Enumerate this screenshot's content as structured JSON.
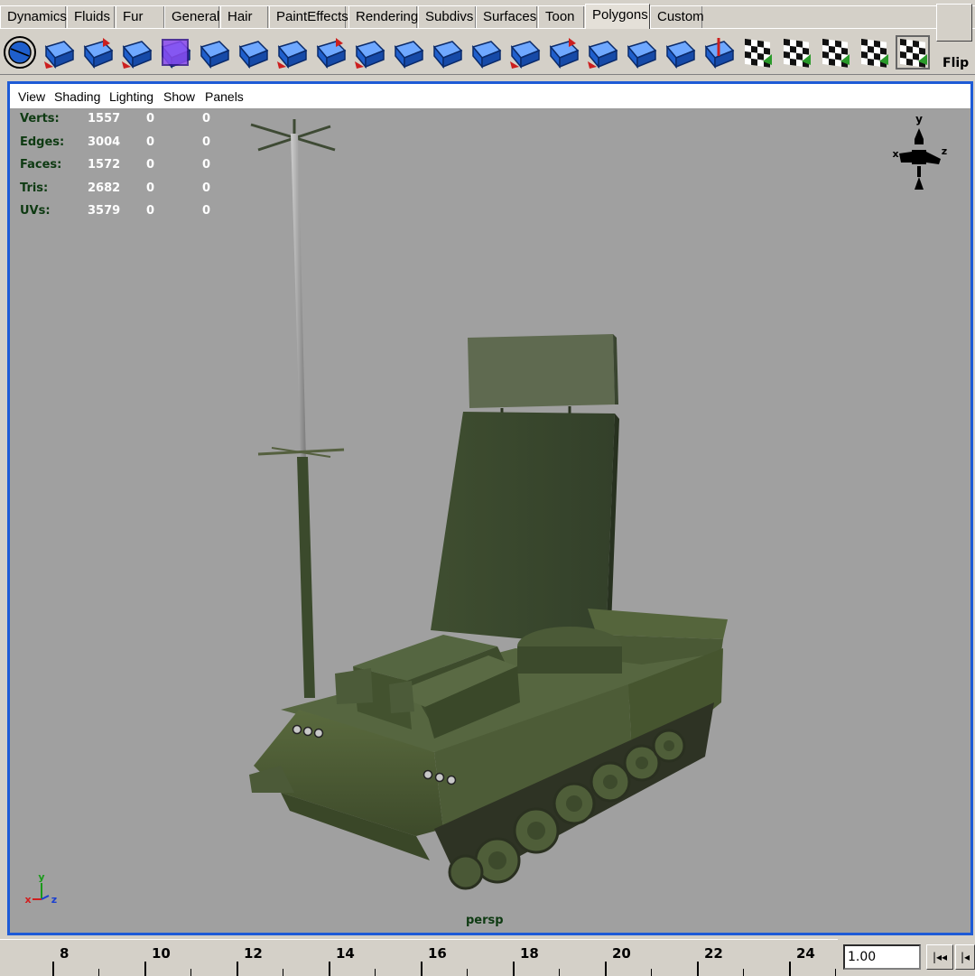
{
  "shelf": {
    "tabs": [
      {
        "label": "Dynamics"
      },
      {
        "label": "Fluids"
      },
      {
        "label": "Fur"
      },
      {
        "label": "General"
      },
      {
        "label": "Hair"
      },
      {
        "label": "PaintEffects"
      },
      {
        "label": "Rendering"
      },
      {
        "label": "Subdivs"
      },
      {
        "label": "Surfaces"
      },
      {
        "label": "Toon"
      },
      {
        "label": "Polygons"
      },
      {
        "label": "Custom"
      }
    ],
    "active_tab": "Polygons",
    "icons": [
      "polygon-sphere-icon",
      "extract-icon",
      "separate-icon",
      "smooth-icon",
      "cube-icon",
      "extrude-face-icon",
      "split-polygon-icon",
      "extrude-edge-icon",
      "bevel-icon",
      "wedge-icon",
      "bridge-icon",
      "append-polygon-icon",
      "merge-vertex-icon",
      "split-edge-icon",
      "subdivide-icon",
      "triangulate-icon",
      "quadrangulate-icon",
      "sculpt-icon",
      "planar-mapping-icon",
      "automatic-mapping-icon",
      "cylindrical-mapping-icon",
      "spherical-mapping-icon",
      "uv-texture-editor-icon",
      "uv-snapshot-icon"
    ],
    "flip_label": "Flip",
    "colors": {
      "icon_blue": "#1f5fcc",
      "icon_light": "#6fa8ff",
      "arrow_red": "#cc1f1f",
      "arrow_green": "#2a9a2a"
    }
  },
  "viewport": {
    "menu": [
      {
        "label": "View"
      },
      {
        "label": "Shading"
      },
      {
        "label": "Lighting"
      },
      {
        "label": "Show"
      },
      {
        "label": "Panels"
      }
    ],
    "hud": [
      {
        "label": "Verts:",
        "v1": "1557",
        "v2": "0",
        "v3": "0"
      },
      {
        "label": "Edges:",
        "v1": "3004",
        "v2": "0",
        "v3": "0"
      },
      {
        "label": "Faces:",
        "v1": "1572",
        "v2": "0",
        "v3": "0"
      },
      {
        "label": "Tris:",
        "v1": "2682",
        "v2": "0",
        "v3": "0"
      },
      {
        "label": "UVs:",
        "v1": "3579",
        "v2": "0",
        "v3": "0"
      }
    ],
    "camera_label": "persp",
    "view_cube_axes": {
      "y": "y",
      "x": "x",
      "z": "z"
    },
    "gizmo_axes": {
      "x": "x",
      "y": "y",
      "z": "z"
    },
    "colors": {
      "border": "#1e5bd6",
      "background": "#a0a0a0",
      "hud_label": "#0e3a12",
      "hud_value": "#ffffff",
      "model_green": "#4c5e34"
    }
  },
  "timeline": {
    "ticks": [
      "8",
      "10",
      "12",
      "14",
      "16",
      "18",
      "20",
      "22",
      "24"
    ],
    "current_time": "1.00",
    "playback_buttons": [
      "|◂◂",
      "|◂"
    ]
  }
}
